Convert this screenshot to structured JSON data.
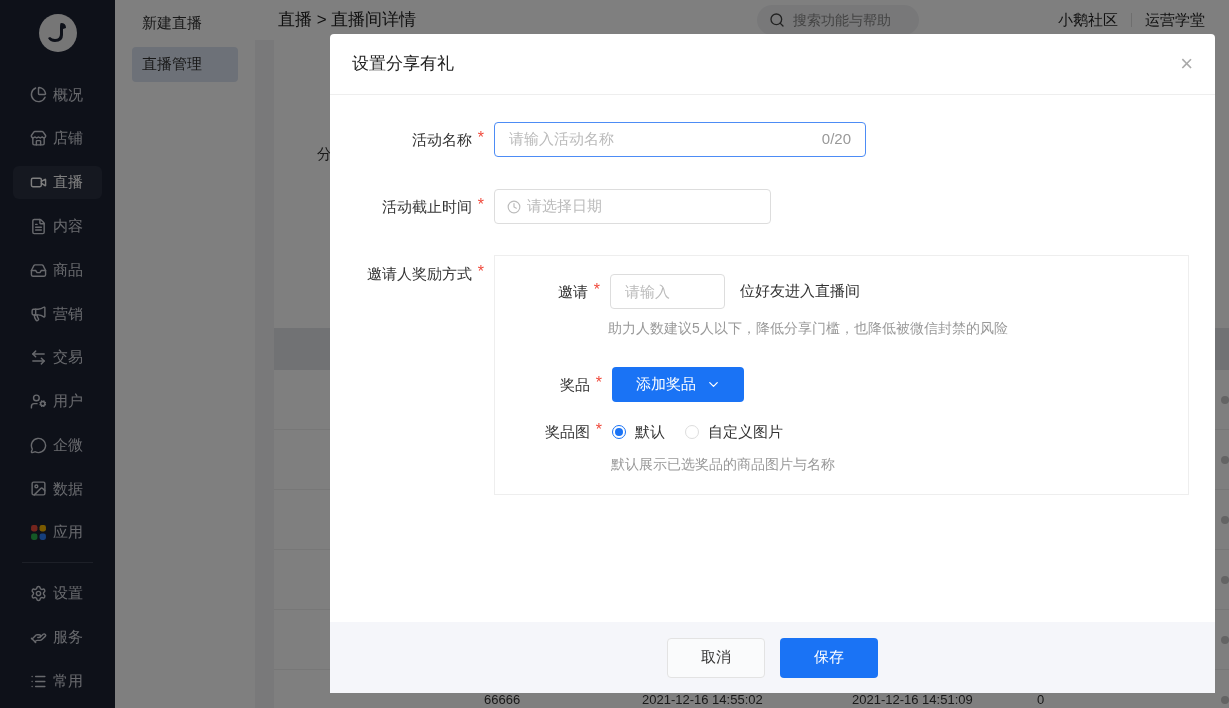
{
  "sidebar": {
    "items": [
      {
        "label": "概况",
        "selected": false
      },
      {
        "label": "店铺",
        "selected": false
      },
      {
        "label": "直播",
        "selected": true
      },
      {
        "label": "内容",
        "selected": false
      },
      {
        "label": "商品",
        "selected": false
      },
      {
        "label": "营销",
        "selected": false
      },
      {
        "label": "交易",
        "selected": false
      },
      {
        "label": "用户",
        "selected": false
      },
      {
        "label": "企微",
        "selected": false
      },
      {
        "label": "数据",
        "selected": false
      },
      {
        "label": "应用",
        "selected": false
      }
    ],
    "bottom_items": [
      {
        "label": "设置",
        "selected": false
      },
      {
        "label": "服务",
        "selected": false
      },
      {
        "label": "常用",
        "selected": false
      }
    ]
  },
  "subnav": {
    "items": [
      {
        "label": "新建直播",
        "selected": false
      },
      {
        "label": "直播管理",
        "selected": true
      }
    ]
  },
  "header": {
    "breadcrumb": [
      "直播",
      "直播间详情"
    ],
    "separator": ">",
    "search": {
      "placeholder": "搜索功能与帮助"
    },
    "links": [
      "小鹅社区",
      "运营学堂"
    ]
  },
  "content": {
    "label": "分",
    "table": {
      "rows": [
        {
          "kind": "hidden"
        },
        {
          "kind": "hidden"
        },
        {
          "kind": "hidden"
        },
        {
          "kind": "hidden"
        },
        {
          "kind": "hidden"
        },
        {
          "kind": "full",
          "cells": [
            "66666",
            "2021-12-16 14:55:02",
            "2021-12-16 14:51:09",
            "0"
          ]
        }
      ]
    }
  },
  "dialog": {
    "title": "设置分享有礼",
    "close": "×",
    "fields": [
      {
        "kind": "text",
        "label": "活动名称",
        "required": true,
        "required_mark": "*",
        "placeholder": "请输入活动名称",
        "counter": "0/20",
        "focused": true
      },
      {
        "kind": "date",
        "label": "活动截止时间",
        "required": true,
        "required_mark": "*",
        "placeholder": "请选择日期"
      }
    ],
    "reward": {
      "label": "邀请人奖励方式",
      "required": true,
      "required_mark": "*",
      "invite": {
        "label": "邀请",
        "required": true,
        "required_mark": "*",
        "placeholder": "请输入",
        "suffix": "位好友进入直播间",
        "help": "助力人数建议5人以下，降低分享门槛，也降低被微信封禁的风险"
      },
      "prize": {
        "label": "奖品",
        "required": true,
        "required_mark": "*",
        "button": "添加奖品"
      },
      "prize_image": {
        "label": "奖品图",
        "required": true,
        "required_mark": "*",
        "options": [
          {
            "label": "默认",
            "selected": true
          },
          {
            "label": "自定义图片",
            "selected": false
          }
        ],
        "help": "默认展示已选奖品的商品图片与名称"
      }
    },
    "buttons": [
      {
        "label": "取消",
        "kind": "secondary"
      },
      {
        "label": "保存",
        "kind": "primary"
      }
    ]
  }
}
